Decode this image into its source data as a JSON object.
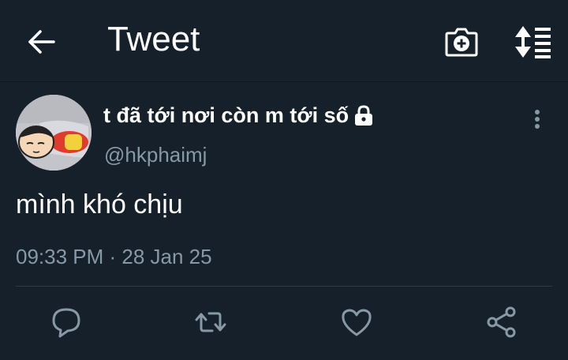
{
  "header": {
    "title": "Tweet",
    "icons": {
      "back": "arrow-left-icon",
      "camera": "camera-plus-icon",
      "sort": "sort-icon"
    }
  },
  "tweet": {
    "author_name": "t đã tới nơi còn m tới số",
    "author_handle": "@hkphaimj",
    "protected": true,
    "text": "mình khó chịu",
    "timestamp": "09:33 PM · 28 Jan 25"
  },
  "actions": [
    "reply-icon",
    "retweet-icon",
    "like-icon",
    "share-icon"
  ],
  "colors": {
    "background": "#15202b",
    "text": "#ffffff",
    "secondary_text": "#8899a6",
    "divider": "#2b3a48",
    "icon": "#8899a6"
  }
}
